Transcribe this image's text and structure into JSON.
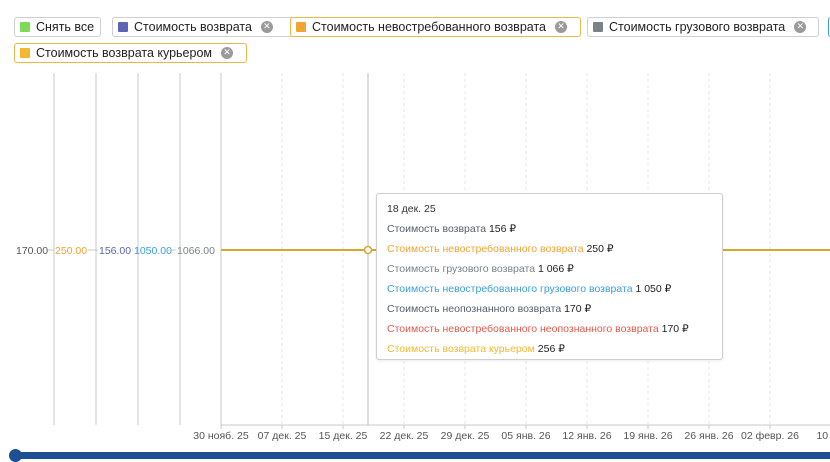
{
  "filters": [
    {
      "label": "Снять все",
      "color": "#7ed957",
      "removable": false
    },
    {
      "label": "Стоимость возврата",
      "color": "#5b64b5",
      "removable": true
    },
    {
      "label": "Стоимость невостребованного возврата",
      "color": "#f0a431",
      "removable": true
    },
    {
      "label": "Стоимость грузового возврата",
      "color": "#7a8288",
      "removable": true
    },
    {
      "label": "Стоимость возврата курьером",
      "color": "#f3b830",
      "removable": true
    }
  ],
  "chart_data": {
    "type": "line",
    "x_dates": [
      "30 нояб. 25",
      "07 дек. 25",
      "15 дек. 25",
      "22 дек. 25",
      "29 дек. 25",
      "05 янв. 26",
      "12 янв. 26",
      "19 янв. 26",
      "26 янв. 26",
      "02 февр. 26",
      "10 фе"
    ],
    "axes": [
      {
        "label": "170.00",
        "color": "#555555"
      },
      {
        "label": "250.00",
        "color": "#f0a431"
      },
      {
        "label": "156.00",
        "color": "#5b64b5"
      },
      {
        "label": "1050.00",
        "color": "#3aa0d8"
      },
      {
        "label": "1066.00",
        "color": "#7a8288"
      }
    ],
    "series": [
      {
        "name": "Стоимость возврата",
        "value": 156,
        "color": "#5b64b5"
      },
      {
        "name": "Стоимость невостребованного возврата",
        "value": 250,
        "color": "#f0a431"
      },
      {
        "name": "Стоимость грузового возврата",
        "value": 1066,
        "color": "#7a8288"
      },
      {
        "name": "Стоимость возврата курьером",
        "value": 256,
        "color": "#d9a52c"
      }
    ],
    "hover_date": "18 дек. 25",
    "grid": true
  },
  "tooltip": {
    "date": "18 дек. 25",
    "rows": [
      {
        "label": "Стоимость возврата",
        "value": "156 ₽",
        "color": "#555e6a"
      },
      {
        "label": "Стоимость невостребованного возврата",
        "value": "250 ₽",
        "color": "#f0a431"
      },
      {
        "label": "Стоимость грузового возврата",
        "value": "1 066 ₽",
        "color": "#7a8288"
      },
      {
        "label": "Стоимость невостребованного грузового возврата",
        "value": "1 050 ₽",
        "color": "#3aa0d8"
      },
      {
        "label": "Стоимость неопознанного возврата",
        "value": "170 ₽",
        "color": "#555e6a"
      },
      {
        "label": "Стоимость невостребованного неопознанного возврата",
        "value": "170 ₽",
        "color": "#e05a4e"
      },
      {
        "label": "Стоимость возврата курьером",
        "value": "256 ₽",
        "color": "#f3b830"
      }
    ]
  }
}
